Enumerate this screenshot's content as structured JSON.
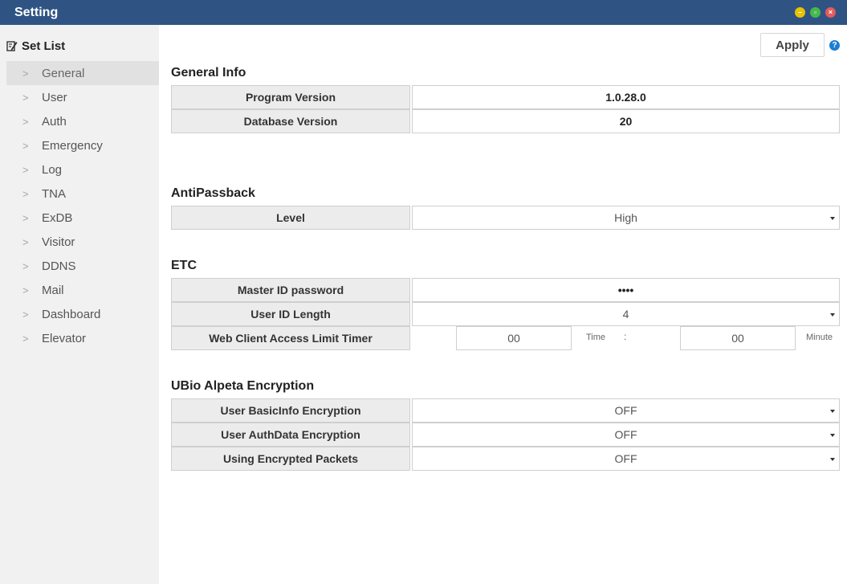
{
  "window": {
    "title": "Setting",
    "controls": [
      "minimize-icon",
      "maximize-icon",
      "close-icon"
    ]
  },
  "sidebar": {
    "header": "Set List",
    "header_icon": "edit-list-icon",
    "items": [
      {
        "label": "General",
        "active": true
      },
      {
        "label": "User"
      },
      {
        "label": "Auth"
      },
      {
        "label": "Emergency"
      },
      {
        "label": "Log"
      },
      {
        "label": "TNA"
      },
      {
        "label": "ExDB"
      },
      {
        "label": "Visitor"
      },
      {
        "label": "DDNS"
      },
      {
        "label": "Mail"
      },
      {
        "label": "Dashboard"
      },
      {
        "label": "Elevator"
      }
    ]
  },
  "toolbar": {
    "apply_label": "Apply",
    "help_icon": "question-icon"
  },
  "general_info": {
    "title": "General Info",
    "rows": [
      {
        "label": "Program Version",
        "value": "1.0.28.0"
      },
      {
        "label": "Database Version",
        "value": "20"
      }
    ]
  },
  "antipassback": {
    "title": "AntiPassback",
    "level": {
      "label": "Level",
      "value": "High"
    }
  },
  "etc": {
    "title": "ETC",
    "master_password": {
      "label": "Master ID password",
      "value": "••••"
    },
    "user_id_length": {
      "label": "User ID Length",
      "value": "4"
    },
    "web_timer": {
      "label": "Web Client Access Limit Timer",
      "hours": "00",
      "hours_unit": "Time",
      "separator": ":",
      "minutes": "00",
      "minutes_unit": "Minute"
    }
  },
  "encryption": {
    "title": "UBio Alpeta Encryption",
    "rows": [
      {
        "label": "User BasicInfo Encryption",
        "value": "OFF"
      },
      {
        "label": "User AuthData Encryption",
        "value": "OFF"
      },
      {
        "label": "Using Encrypted Packets",
        "value": "OFF"
      }
    ]
  },
  "colors": {
    "titlebar": "#2f5484",
    "sidebar_bg": "#f1f1f1",
    "active_item": "#e1e1e1",
    "label_cell": "#ececec",
    "help_icon": "#1c7dd2"
  }
}
